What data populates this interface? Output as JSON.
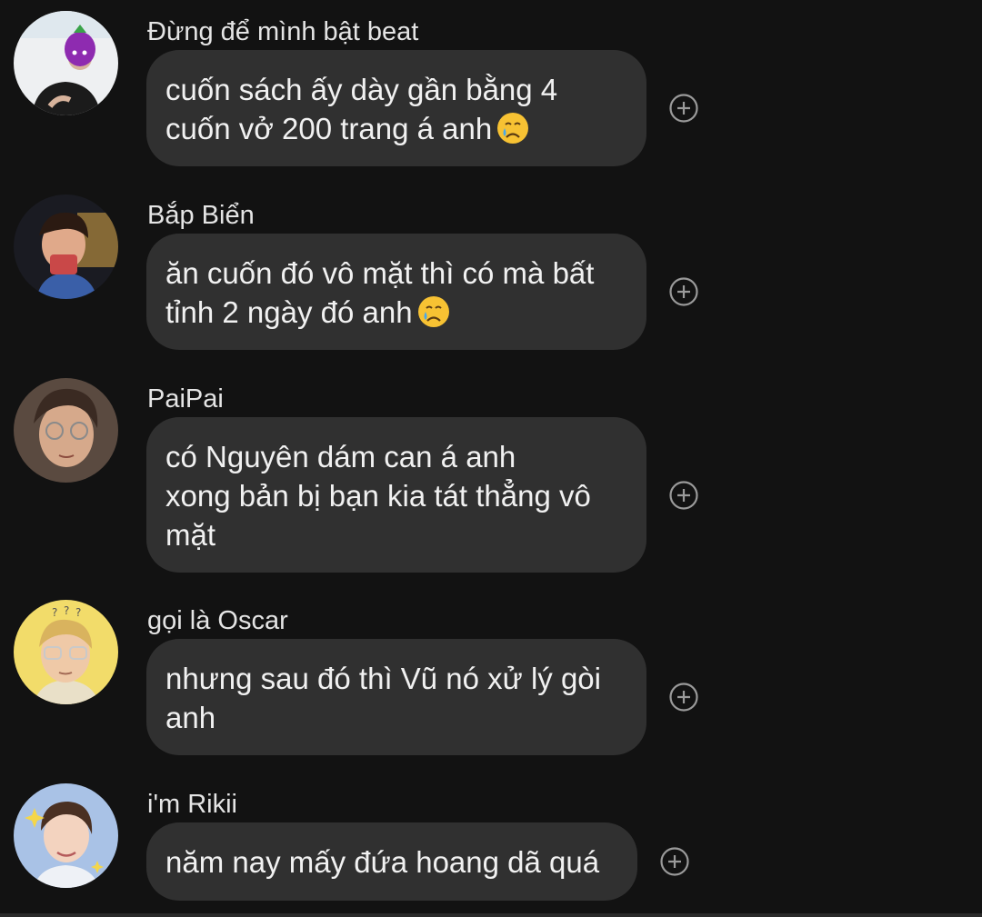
{
  "messages": [
    {
      "sender": "Đừng để mình bật beat",
      "text": "cuốn sách ấy dày gần bằng 4\ncuốn vở 200 trang á anh",
      "emoji": "crying-face"
    },
    {
      "sender": "Bắp Biển",
      "text": "ăn cuốn đó vô mặt thì có mà bất\ntỉnh 2 ngày đó anh",
      "emoji": "crying-face"
    },
    {
      "sender": "PaiPai",
      "text": "có Nguyên dám can á anh\nxong bản bị bạn kia tát thẳng vô\nmặt",
      "emoji": null
    },
    {
      "sender": "gọi là Oscar",
      "text": "nhưng sau đó thì Vũ nó xử lý gòi\nanh",
      "emoji": null
    },
    {
      "sender": "i'm Rikii",
      "text": "năm nay mấy đứa hoang dã quá",
      "emoji": null
    }
  ],
  "icons": {
    "react": "add-reaction-icon",
    "emoji": "crying-face-emoji"
  },
  "colors": {
    "background": "#121212",
    "bubble": "#303030",
    "text": "#f1f1f1",
    "sender": "#e4e4e4",
    "react_icon": "#9a9a9a"
  }
}
